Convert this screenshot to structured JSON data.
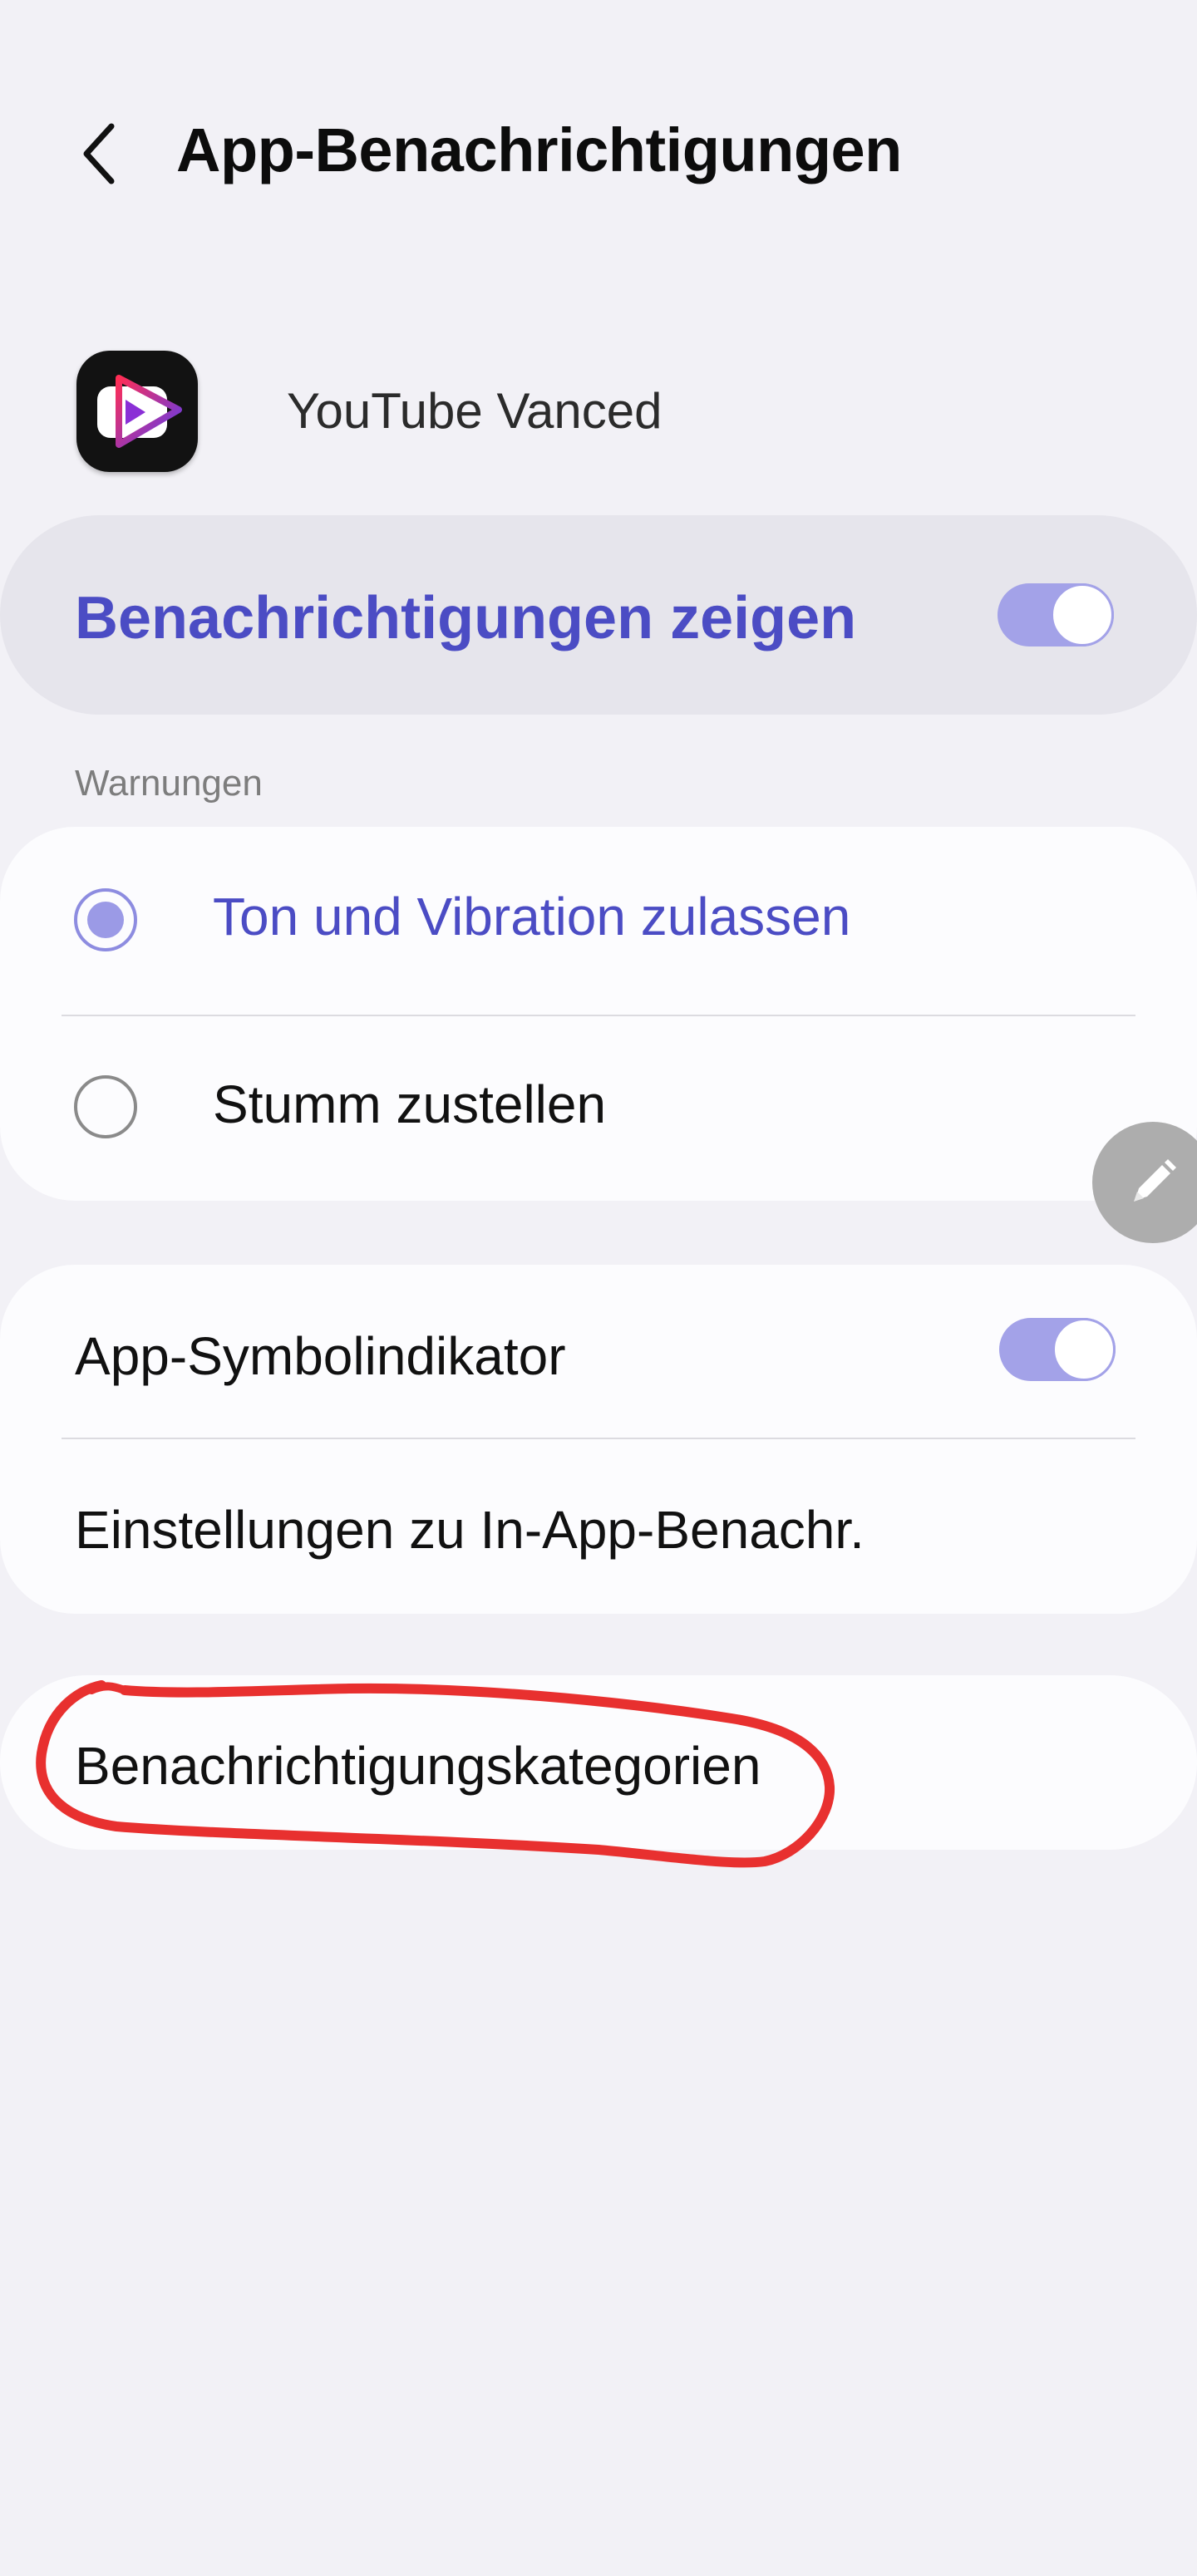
{
  "header": {
    "title": "App-Benachrichtigungen",
    "back_icon": "chevron-left-icon"
  },
  "app": {
    "name": "YouTube Vanced",
    "icon": "youtube-vanced-app-icon"
  },
  "master_switch": {
    "label": "Benachrichtigungen zeigen",
    "enabled": true
  },
  "alerts_section": {
    "label": "Warnungen",
    "options": [
      {
        "label": "Ton und Vibration zulassen",
        "selected": true
      },
      {
        "label": "Stumm zustellen",
        "selected": false
      }
    ]
  },
  "settings_card": {
    "badge": {
      "label": "App-Symbolindikator",
      "enabled": true
    },
    "in_app": {
      "label": "Einstellungen zu In-App-Benachr."
    }
  },
  "categories": {
    "label": "Benachrichtigungskategorien"
  },
  "colors": {
    "accent": "#4b4cc4",
    "toggle_track": "#a3a2e8",
    "background": "#f2f1f6",
    "card": "#fcfcfe",
    "annotation": "#e8302f"
  }
}
